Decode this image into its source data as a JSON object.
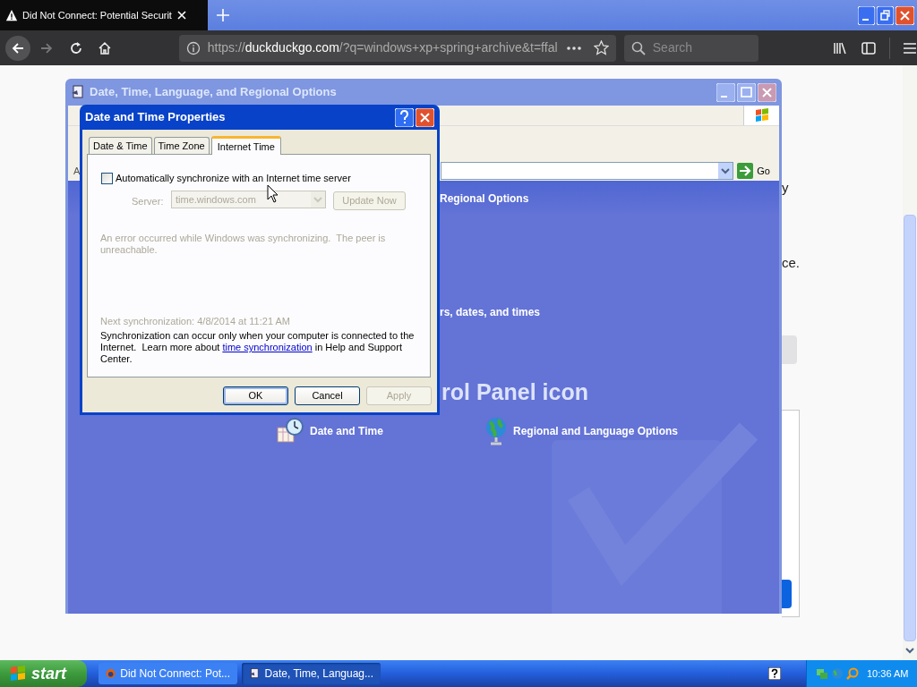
{
  "browser": {
    "tab_title": "Did Not Connect: Potential Securit",
    "url": {
      "scheme": "https://",
      "host": "duckduckgo.com",
      "rest": "/?q=windows+xp+spring+archive&t=ffal"
    },
    "search": {
      "placeholder": "Search"
    }
  },
  "page_fragments": [
    "y",
    "ce."
  ],
  "back_window": {
    "title": "Date, Time, Language, and Regional Options",
    "address_label": "A",
    "go_button": "Go",
    "header": "Regional Options",
    "task": "rs, dates, and times",
    "heading": "rol Panel icon",
    "icons": [
      {
        "label": "Date and Time",
        "kind": "clock"
      },
      {
        "label": "Regional and Language Options",
        "kind": "globe"
      }
    ]
  },
  "dialog": {
    "title": "Date and Time Properties",
    "tabs": [
      {
        "label": "Date & Time",
        "selected": false
      },
      {
        "label": "Time Zone",
        "selected": false
      },
      {
        "label": "Internet Time",
        "selected": true
      }
    ],
    "sync_checkbox": {
      "label": "Automatically synchronize with an Internet time server",
      "checked": false
    },
    "server": {
      "label": "Server:",
      "value": "time.windows.com",
      "disabled": true
    },
    "update_button": {
      "label": "Update Now",
      "disabled": true
    },
    "error_text": "An error occurred while Windows was synchronizing.  The peer is unreachable.",
    "next_sync": "Next synchronization: 4/8/2014 at 11:21 AM",
    "info": {
      "before": "Synchronization can occur only when your computer is connected to the Internet.  Learn more about",
      "link": "time synchronization",
      "after": "in Help and Support Center."
    },
    "buttons": [
      {
        "label": "OK",
        "disabled": false
      },
      {
        "label": "Cancel",
        "disabled": false
      },
      {
        "label": "Apply",
        "disabled": true
      }
    ]
  },
  "taskbar": {
    "start": "start",
    "tasks": [
      {
        "label": "Did Not Connect: Pot...",
        "selected": false
      },
      {
        "label": "Date, Time, Languag...",
        "selected": true
      }
    ],
    "clock": "10:36 AM"
  }
}
